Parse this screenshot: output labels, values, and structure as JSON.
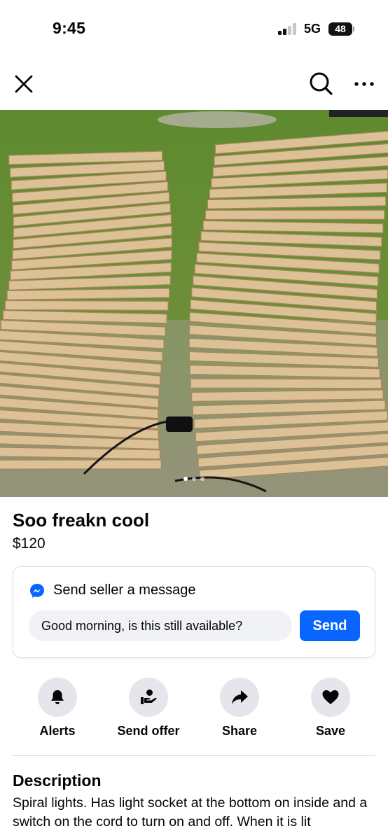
{
  "status_bar": {
    "time": "9:45",
    "network": "5G",
    "battery": "48"
  },
  "nav": {
    "close_icon": "close-icon",
    "search_icon": "search-icon",
    "more_icon": "more-icon"
  },
  "listing": {
    "carousel": {
      "total_images": 3,
      "current_image": 1
    },
    "title": "Soo freakn cool",
    "price": "$120"
  },
  "message_card": {
    "title": "Send seller a message",
    "input_value": "Good morning, is this still available?",
    "send_label": "Send",
    "icon": "messenger-icon"
  },
  "actions": [
    {
      "label": "Alerts",
      "icon": "bell-icon"
    },
    {
      "label": "Send offer",
      "icon": "send-offer-icon"
    },
    {
      "label": "Share",
      "icon": "share-icon"
    },
    {
      "label": "Save",
      "icon": "heart-icon"
    }
  ],
  "description": {
    "heading": "Description",
    "text": "Spiral lights. Has light socket at the bottom on inside and a switch on the cord to turn on and off. When it is lit"
  },
  "colors": {
    "accent": "#0866ff",
    "button_bg": "#e4e6eb",
    "input_bg": "#f0f2f5"
  }
}
